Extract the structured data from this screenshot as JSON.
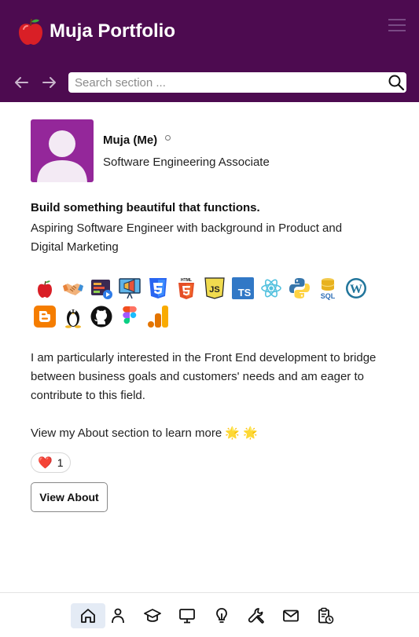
{
  "header": {
    "title": "Muja Portfolio",
    "logo_icon": "apple-icon",
    "menu_icon": "hamburger-menu-icon",
    "search": {
      "placeholder": "Search section ...",
      "value": ""
    }
  },
  "profile": {
    "name": "Muja (Me)",
    "role": "Software Engineering Associate"
  },
  "intro": {
    "headline": "Build something beautiful that functions.",
    "text": "Aspiring Software Engineer with background in Product and Digital Marketing"
  },
  "skills": [
    "apple",
    "handshake",
    "video-editing",
    "marketing",
    "css3",
    "html5",
    "javascript",
    "typescript",
    "react",
    "python",
    "sql",
    "wordpress",
    "blogger",
    "linux",
    "github",
    "figma",
    "google-analytics"
  ],
  "body": {
    "paragraph": "I am particularly interested in the Front End development to bridge between business goals and customers' needs and am eager to contribute to this field.",
    "cta_text": "View my About section to learn more 🌟 🌟"
  },
  "reaction": {
    "emoji": "❤️",
    "count": "1"
  },
  "about_button": "View About",
  "bottom_nav": [
    "home",
    "about",
    "education",
    "projects",
    "ideas",
    "skills",
    "contact",
    "resume"
  ],
  "colors": {
    "header": "#4d0b50",
    "avatar": "#94279a",
    "active_nav": "#e4ebf5"
  }
}
